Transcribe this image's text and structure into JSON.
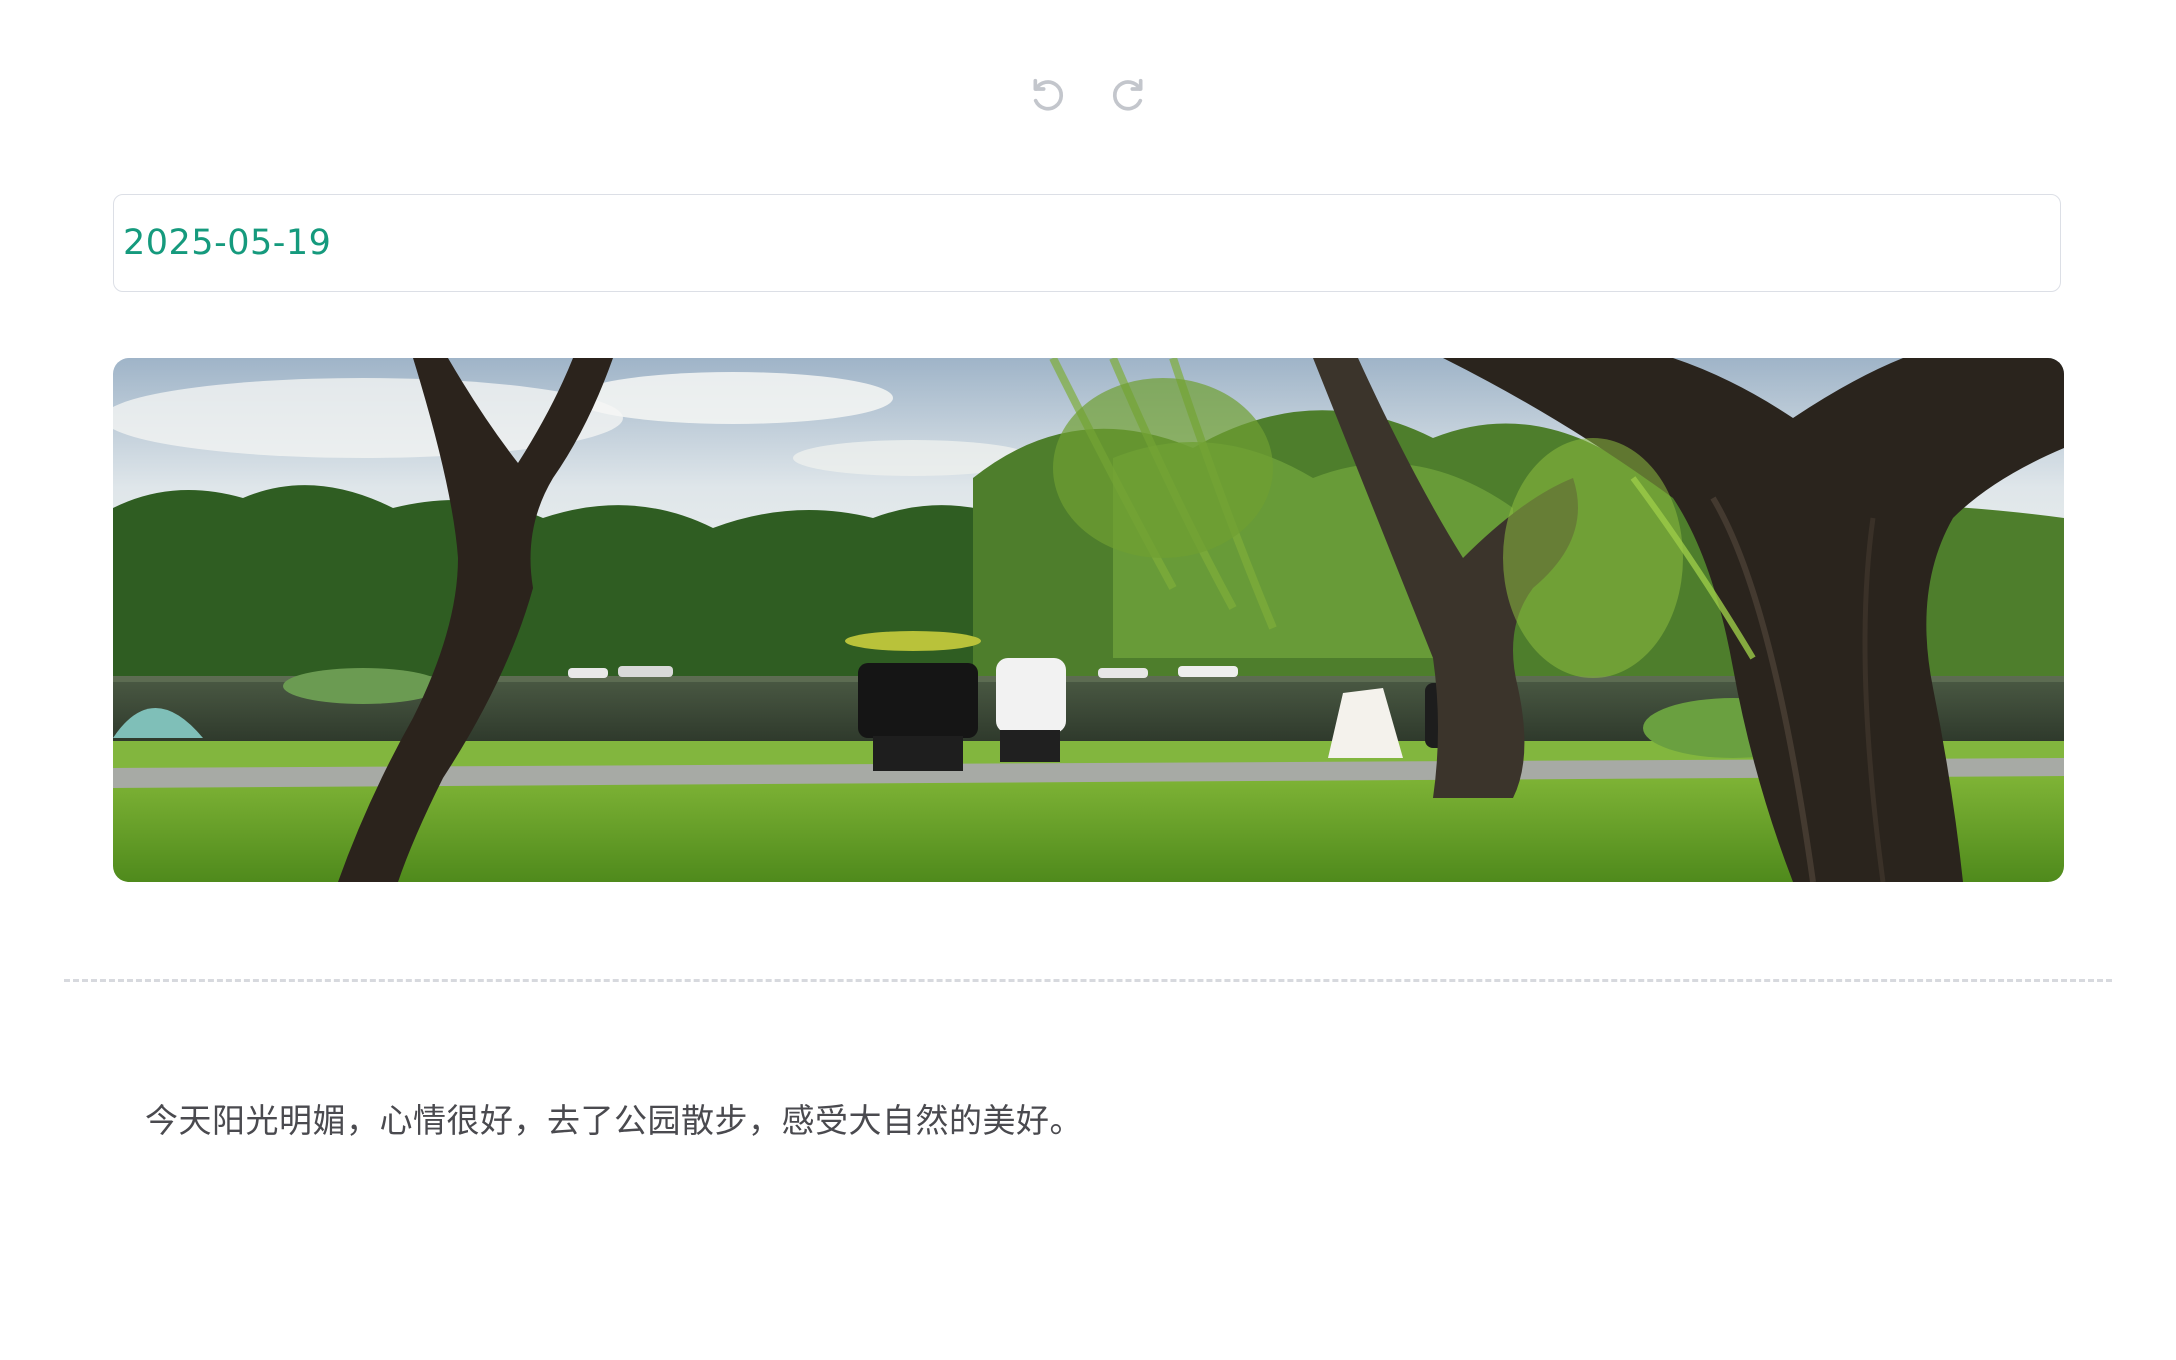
{
  "toolbar": {
    "undo_icon": "undo-icon",
    "redo_icon": "redo-icon",
    "icon_color": "#c3c6cc"
  },
  "entry": {
    "date": "2025-05-19",
    "date_color": "#159a7d",
    "photo_subject": "park-photo",
    "text": "今天阳光明媚，心情很好，去了公园散步，感受大自然的美好。"
  }
}
